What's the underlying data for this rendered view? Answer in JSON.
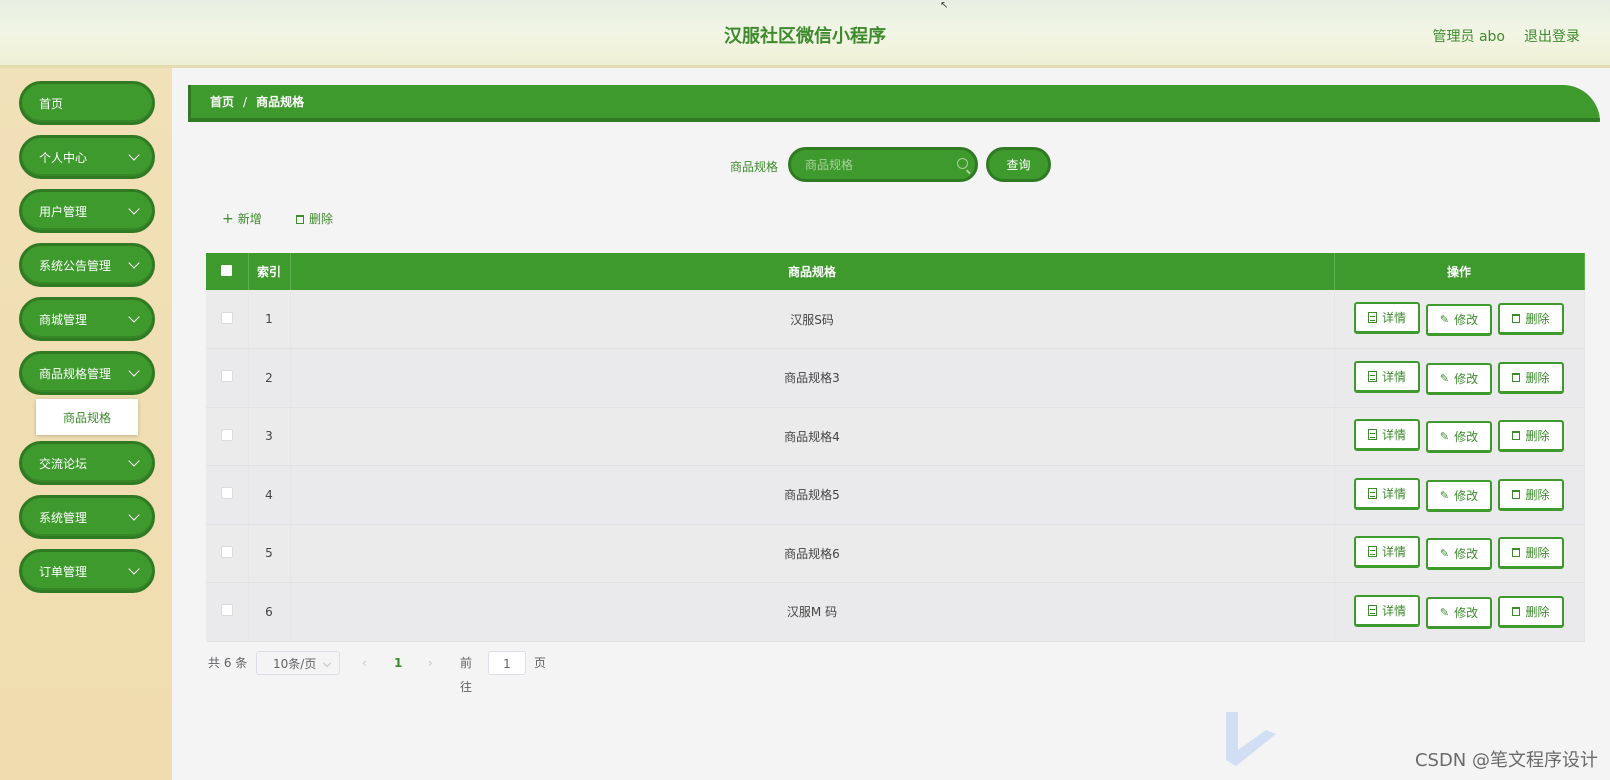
{
  "header": {
    "title": "汉服社区微信小程序",
    "user": "管理员 abo",
    "logout": "退出登录"
  },
  "sidebar": {
    "items": [
      {
        "label": "首页",
        "has_children": false
      },
      {
        "label": "个人中心",
        "has_children": true
      },
      {
        "label": "用户管理",
        "has_children": true
      },
      {
        "label": "系统公告管理",
        "has_children": true
      },
      {
        "label": "商城管理",
        "has_children": true
      },
      {
        "label": "商品规格管理",
        "has_children": true
      },
      {
        "label": "交流论坛",
        "has_children": true
      },
      {
        "label": "系统管理",
        "has_children": true
      },
      {
        "label": "订单管理",
        "has_children": true
      }
    ],
    "submenu": {
      "label": "商品规格"
    }
  },
  "breadcrumb": {
    "home": "首页",
    "separator": "/",
    "current": "商品规格"
  },
  "search": {
    "label": "商品规格",
    "placeholder": "商品规格",
    "button": "查询"
  },
  "actions": {
    "add": "新增",
    "delete": "删除"
  },
  "table": {
    "columns": [
      "索引",
      "商品规格",
      "操作"
    ],
    "rows": [
      {
        "index": "1",
        "spec": "汉服S码"
      },
      {
        "index": "2",
        "spec": "商品规格3"
      },
      {
        "index": "3",
        "spec": "商品规格4"
      },
      {
        "index": "4",
        "spec": "商品规格5"
      },
      {
        "index": "5",
        "spec": "商品规格6"
      },
      {
        "index": "6",
        "spec": "汉服M 码"
      }
    ],
    "row_actions": {
      "detail": "详情",
      "edit": "修改",
      "delete": "删除"
    }
  },
  "pagination": {
    "total": "共 6 条",
    "page_size": "10条/页",
    "prev": "‹",
    "current": "1",
    "next": "›",
    "goto": "前往",
    "goto_value": "1",
    "page_suffix": "页"
  },
  "watermark": "CSDN @笔文程序设计",
  "colors": {
    "primary": "#3f9a2e",
    "primary_dark": "#2f7a23",
    "sidebar_bg": "#f0dcae",
    "text_green": "#3d8b2d"
  }
}
